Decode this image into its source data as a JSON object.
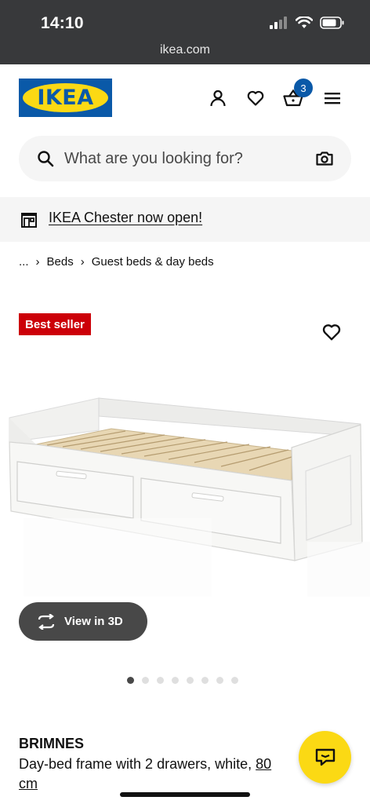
{
  "status_bar": {
    "time": "14:10",
    "url": "ikea.com"
  },
  "header": {
    "logo_text": "IKEA",
    "icons": [
      "person-icon",
      "heart-icon",
      "basket-icon",
      "menu-icon"
    ],
    "cart_count": "3"
  },
  "search": {
    "placeholder": "What are you looking for?"
  },
  "banner": {
    "text": "IKEA Chester now open!"
  },
  "breadcrumb": {
    "ellipsis": "...",
    "items": [
      "Beds",
      "Guest beds & day beds"
    ]
  },
  "product": {
    "badge": "Best seller",
    "view_3d": "View in 3D",
    "image_count": 8,
    "active_image": 1,
    "name": "BRIMNES",
    "description_text": "Day-bed frame with 2 drawers, white, ",
    "description_link": "80",
    "description_rest": "cm"
  },
  "colors": {
    "ikea_blue": "#0a59a8",
    "ikea_yellow": "#fbd914",
    "badge_red": "#cc0008",
    "dark_gray": "#484848"
  }
}
